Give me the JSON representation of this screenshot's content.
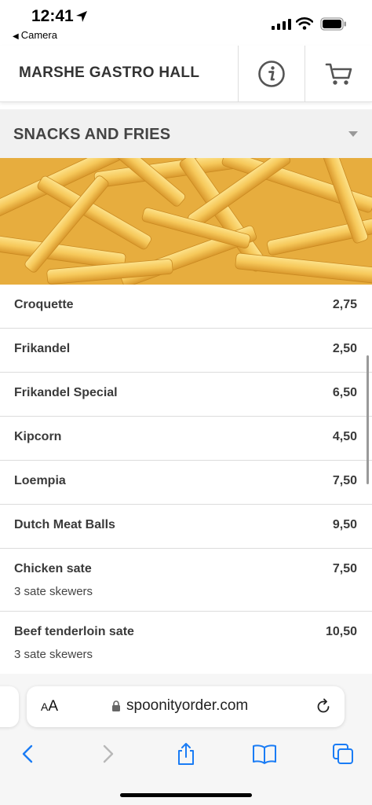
{
  "status_bar": {
    "time": "12:41",
    "back_app": "Camera"
  },
  "header": {
    "title": "MARSHE GASTRO HALL"
  },
  "category": {
    "title": "SNACKS AND FRIES"
  },
  "menu": {
    "items": [
      {
        "name": "Croquette",
        "price": "2,75"
      },
      {
        "name": "Frikandel",
        "price": "2,50"
      },
      {
        "name": "Frikandel Special",
        "price": "6,50"
      },
      {
        "name": "Kipcorn",
        "price": "4,50"
      },
      {
        "name": "Loempia",
        "price": "7,50"
      },
      {
        "name": "Dutch Meat Balls",
        "price": "9,50"
      },
      {
        "name": "Chicken sate",
        "price": "7,50",
        "description": "3 sate skewers"
      },
      {
        "name": "Beef tenderloin sate",
        "price": "10,50",
        "description": "3 sate skewers"
      }
    ]
  },
  "browser": {
    "text_size_label_big": "A",
    "text_size_label_small": "A",
    "url": "spoonityorder.com"
  },
  "colors": {
    "accent_blue": "#1a7cf5",
    "category_bg": "#f1f1f1",
    "text_dark": "#3a3a3a"
  }
}
